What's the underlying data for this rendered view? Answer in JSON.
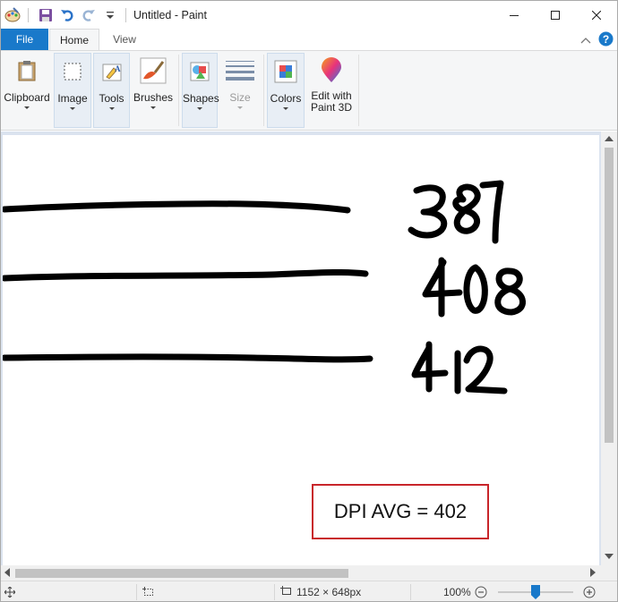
{
  "window": {
    "title": "Untitled - Paint"
  },
  "tabs": {
    "file": "File",
    "home": "Home",
    "view": "View"
  },
  "ribbon": {
    "clipboard": "Clipboard",
    "image": "Image",
    "tools": "Tools",
    "brushes": "Brushes",
    "shapes": "Shapes",
    "size": "Size",
    "colors": "Colors",
    "edit3d_line1": "Edit with",
    "edit3d_line2": "Paint 3D"
  },
  "canvas": {
    "numbers": [
      "387",
      "408",
      "412"
    ],
    "dpi_text": "DPI AVG = 402",
    "accent": "#c8252a"
  },
  "status": {
    "image_size": "1152 × 648px",
    "zoom": "100%"
  },
  "colors": {
    "file_tab": "#1979ca",
    "ribbon_bg": "#f5f6f7",
    "workspace_bg": "#dbe3ef"
  },
  "icons": [
    "paint-app-icon",
    "save-icon",
    "undo-icon",
    "redo-icon",
    "customize-qat-icon",
    "minimize-icon",
    "maximize-icon",
    "close-icon",
    "collapse-ribbon-icon",
    "help-icon",
    "clipboard-icon",
    "image-select-icon",
    "tools-icon",
    "brush-icon",
    "shapes-icon",
    "size-icon",
    "colors-icon",
    "paint3d-icon",
    "move-cursor-icon",
    "selection-size-icon",
    "image-size-icon",
    "zoom-out-icon",
    "zoom-in-icon"
  ]
}
